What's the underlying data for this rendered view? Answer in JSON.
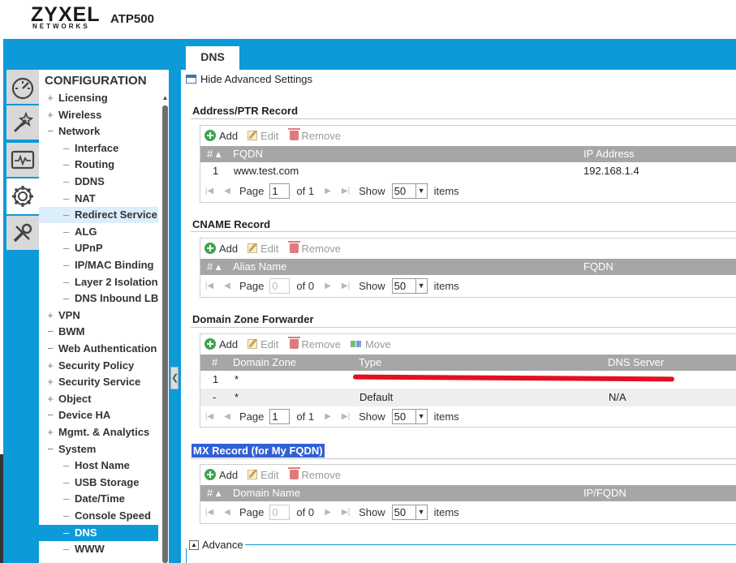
{
  "header": {
    "logo": "ZYXEL",
    "logo_sub": "NETWORKS",
    "model": "ATP500"
  },
  "icons": [
    "dashboard-icon",
    "wizard-icon",
    "monitor-icon",
    "configuration-gear-icon",
    "maintenance-tools-icon"
  ],
  "sidebar": {
    "title": "CONFIGURATION",
    "items": [
      {
        "sign": "+",
        "label": "Licensing",
        "level": 1
      },
      {
        "sign": "+",
        "label": "Wireless",
        "level": 1
      },
      {
        "sign": "−",
        "label": "Network",
        "level": 1
      },
      {
        "label": "Interface",
        "level": 2
      },
      {
        "label": "Routing",
        "level": 2
      },
      {
        "label": "DDNS",
        "level": 2
      },
      {
        "label": "NAT",
        "level": 2
      },
      {
        "label": "Redirect Service",
        "level": 2,
        "state": "hover"
      },
      {
        "label": "ALG",
        "level": 2
      },
      {
        "label": "UPnP",
        "level": 2
      },
      {
        "label": "IP/MAC Binding",
        "level": 2
      },
      {
        "label": "Layer 2 Isolation",
        "level": 2
      },
      {
        "label": "DNS Inbound LB",
        "level": 2
      },
      {
        "sign": "+",
        "label": "VPN",
        "level": 1
      },
      {
        "sign": "−",
        "label": "BWM",
        "level": 1
      },
      {
        "sign": "−",
        "label": "Web Authentication",
        "level": 1
      },
      {
        "sign": "+",
        "label": "Security Policy",
        "level": 1
      },
      {
        "sign": "+",
        "label": "Security Service",
        "level": 1
      },
      {
        "sign": "+",
        "label": "Object",
        "level": 1
      },
      {
        "sign": "−",
        "label": "Device HA",
        "level": 1
      },
      {
        "sign": "+",
        "label": "Mgmt. & Analytics",
        "level": 1
      },
      {
        "sign": "−",
        "label": "System",
        "level": 1
      },
      {
        "label": "Host Name",
        "level": 2
      },
      {
        "label": "USB Storage",
        "level": 2
      },
      {
        "label": "Date/Time",
        "level": 2
      },
      {
        "label": "Console Speed",
        "level": 2
      },
      {
        "label": "DNS",
        "level": 2,
        "state": "selected"
      },
      {
        "label": "WWW",
        "level": 2
      }
    ]
  },
  "tab": {
    "label": "DNS"
  },
  "main": {
    "hide_advanced": "Hide Advanced Settings",
    "toolbar": {
      "add": "Add",
      "edit": "Edit",
      "remove": "Remove",
      "move": "Move"
    },
    "pager": {
      "page": "Page",
      "show": "Show",
      "items": "items",
      "first": "|◀",
      "prev": "◀",
      "next": "▶",
      "last": "▶|",
      "arrow": "▼"
    },
    "address_ptr": {
      "title": "Address/PTR Record",
      "headers": [
        "# ▴",
        "FQDN",
        "IP Address"
      ],
      "rows": [
        [
          "1",
          "www.test.com",
          "192.168.1.4"
        ]
      ],
      "page_value": "1",
      "of": "of 1",
      "show_value": "50"
    },
    "cname": {
      "title": "CNAME Record",
      "headers": [
        "# ▴",
        "Alias Name",
        "FQDN"
      ],
      "page_value": "0",
      "of": "of 0",
      "show_value": "50"
    },
    "domain_zone": {
      "title": "Domain Zone Forwarder",
      "headers": [
        "#",
        "Domain Zone",
        "Type",
        "DNS Server"
      ],
      "rows": [
        [
          "1",
          "*",
          "",
          ""
        ],
        [
          "-",
          "*",
          "Default",
          "N/A"
        ]
      ],
      "page_value": "1",
      "of": "of 1",
      "show_value": "50"
    },
    "mx": {
      "title": "MX Record (for My FQDN)",
      "headers": [
        "# ▴",
        "Domain Name",
        "IP/FQDN"
      ],
      "page_value": "0",
      "of": "of 0",
      "show_value": "50"
    },
    "advance": {
      "label": "Advance",
      "toggle": "▲"
    }
  },
  "colors": {
    "accent": "#0d9ad9",
    "header_row": "#a6a6a6",
    "redaction": "#e3101f",
    "selection": "#3260d4"
  }
}
